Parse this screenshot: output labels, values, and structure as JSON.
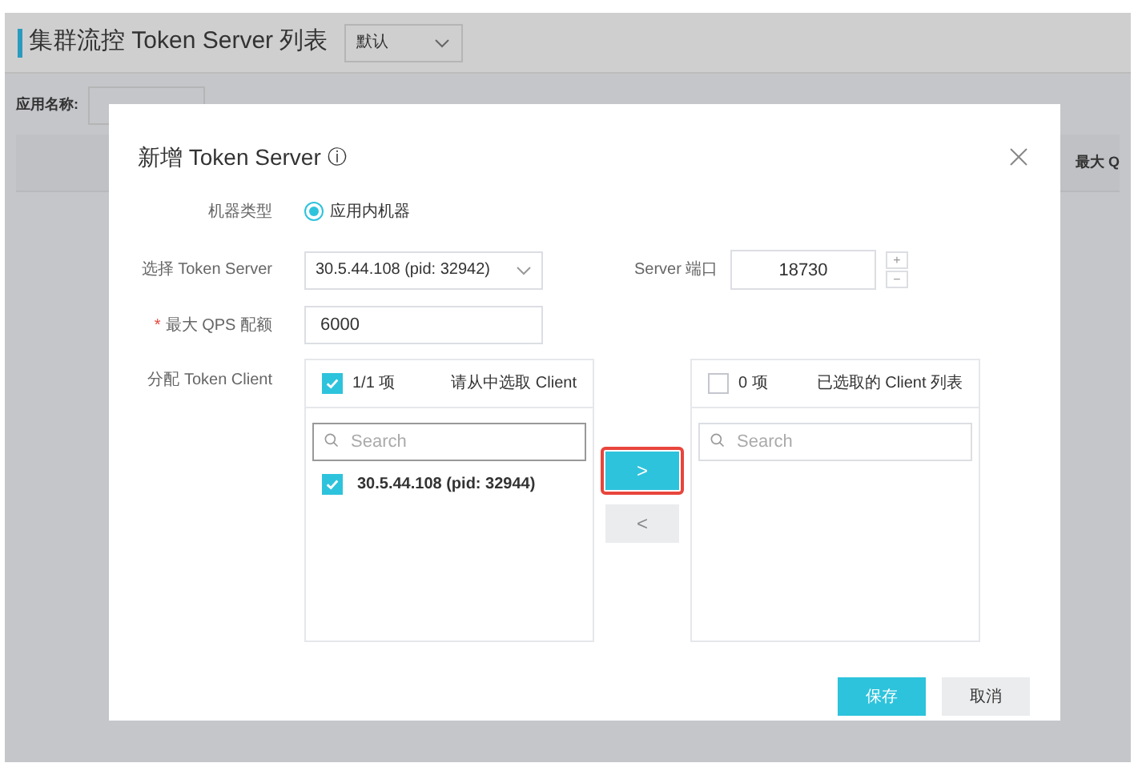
{
  "page": {
    "title": "集群流控 Token Server 列表",
    "mode_select": {
      "value": "默认"
    },
    "app_label": "应用名称:",
    "table": {
      "columns": [
        "最大 Q"
      ]
    }
  },
  "dialog": {
    "title": "新增 Token Server",
    "info_icon": "ⓘ",
    "machine_type": {
      "label": "机器类型",
      "options": [
        {
          "label": "应用内机器",
          "selected": true
        }
      ]
    },
    "server_select": {
      "label": "选择 Token Server",
      "value": "30.5.44.108 (pid: 32942)"
    },
    "port": {
      "label": "Server 端口",
      "value": "18730",
      "plus": "+",
      "minus": "−"
    },
    "qps": {
      "label": "最大 QPS 配额",
      "required_mark": "*",
      "value": "6000"
    },
    "clients": {
      "label": "分配 Token Client",
      "source": {
        "checked": true,
        "count": "1/1 项",
        "title": "请从中选取 Client",
        "search": {
          "placeholder": "Search"
        },
        "items": [
          {
            "label": "30.5.44.108 (pid: 32944)",
            "checked": true
          }
        ]
      },
      "move_right": {
        "label": ">",
        "disabled": false,
        "highlighted": true
      },
      "move_left": {
        "label": "<",
        "disabled": true,
        "highlighted": false
      },
      "target": {
        "checked": false,
        "count": "0 项",
        "title": "已选取的 Client 列表",
        "search": {
          "placeholder": "Search"
        }
      }
    },
    "buttons": [
      {
        "label": "保存",
        "kind": "primary"
      },
      {
        "label": "取消",
        "kind": "secondary"
      }
    ]
  }
}
